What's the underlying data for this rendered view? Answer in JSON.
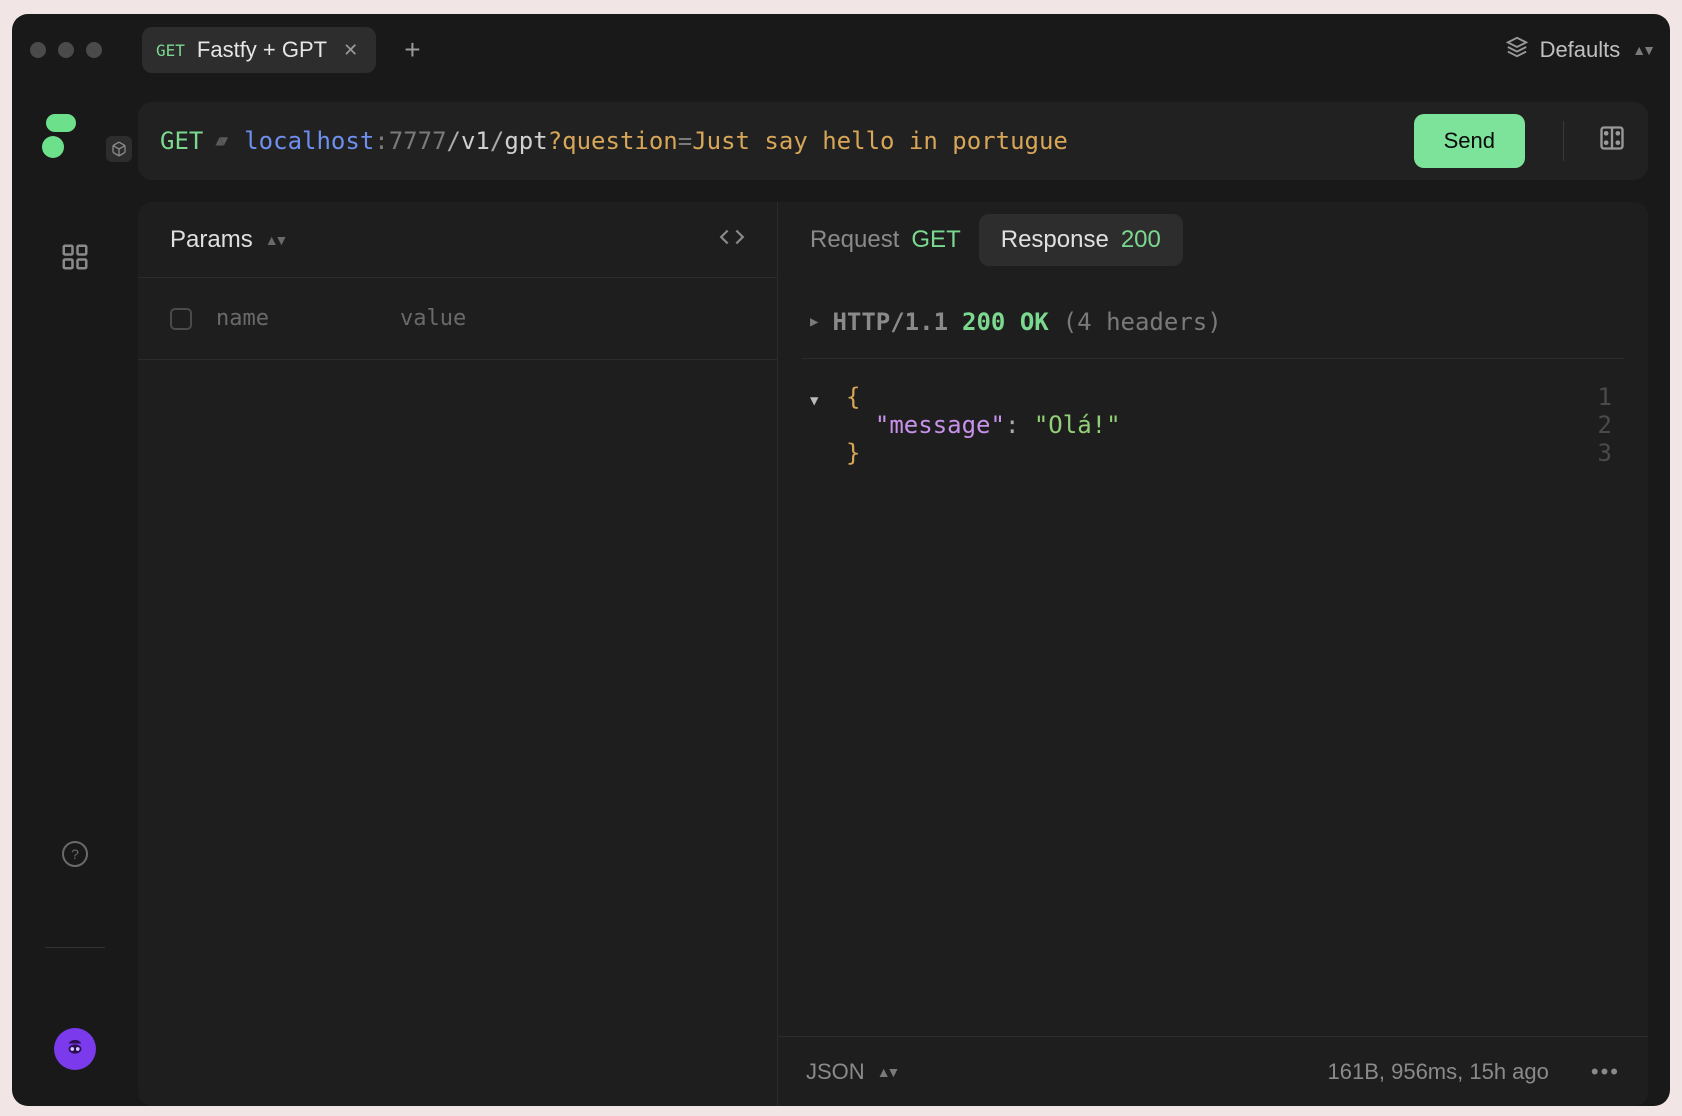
{
  "titlebar": {
    "environment": "Defaults",
    "tab": {
      "method": "GET",
      "title": "Fastfy + GPT"
    }
  },
  "request": {
    "method": "GET",
    "url": {
      "host": "localhost",
      "port": "7777",
      "path_segments": [
        "v1",
        "gpt"
      ],
      "param_name": "question",
      "param_value": "Just say hello in portugue"
    },
    "send_label": "Send"
  },
  "left_panel": {
    "tab_label": "Params",
    "header_name": "name",
    "header_value": "value"
  },
  "right_panel": {
    "request_tab": {
      "label": "Request",
      "method": "GET"
    },
    "response_tab": {
      "label": "Response",
      "code": "200"
    },
    "status": {
      "protocol": "HTTP/1.1",
      "code_text": "200 OK",
      "headers_text": "(4 headers)"
    },
    "json_lines": {
      "l1": "{",
      "l2_key": "\"message\"",
      "l2_colon": ":",
      "l2_val": "\"Olá!\"",
      "l3": "}"
    },
    "footer": {
      "format": "JSON",
      "meta": "161B, 956ms, 15h ago"
    }
  }
}
